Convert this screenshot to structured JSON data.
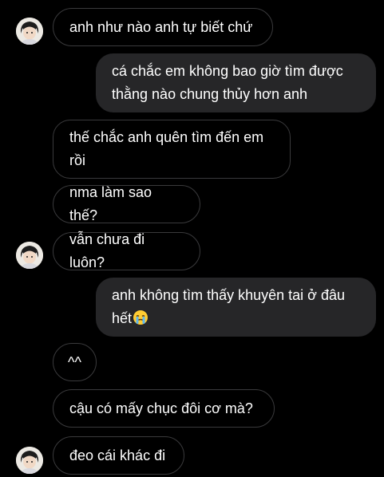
{
  "messages": [
    {
      "sender": "them",
      "text": "anh như nào anh tự biết chứ"
    },
    {
      "sender": "me",
      "lines": [
        "cá chắc em không bao giờ tìm được",
        "thằng nào chung thủy hơn anh"
      ]
    },
    {
      "sender": "them",
      "lines": [
        "thế chắc anh quên tìm đến em",
        "rồi"
      ]
    },
    {
      "sender": "them",
      "text": "nma làm sao thế?"
    },
    {
      "sender": "them",
      "text": "vẫn chưa đi luôn?"
    },
    {
      "sender": "me",
      "lines": [
        "anh không tìm thấy khuyên tai ở đâu",
        "hết"
      ],
      "emoji": "crying-face-emoji"
    },
    {
      "sender": "them",
      "text": "^^"
    },
    {
      "sender": "them",
      "text": "cậu có mấy chục đôi cơ mà?"
    },
    {
      "sender": "them",
      "text": "đeo cái khác đi"
    }
  ],
  "colors": {
    "background": "#000000",
    "incoming_border": "#3a3a3c",
    "outgoing_fill": "#262628",
    "text": "#ffffff"
  }
}
